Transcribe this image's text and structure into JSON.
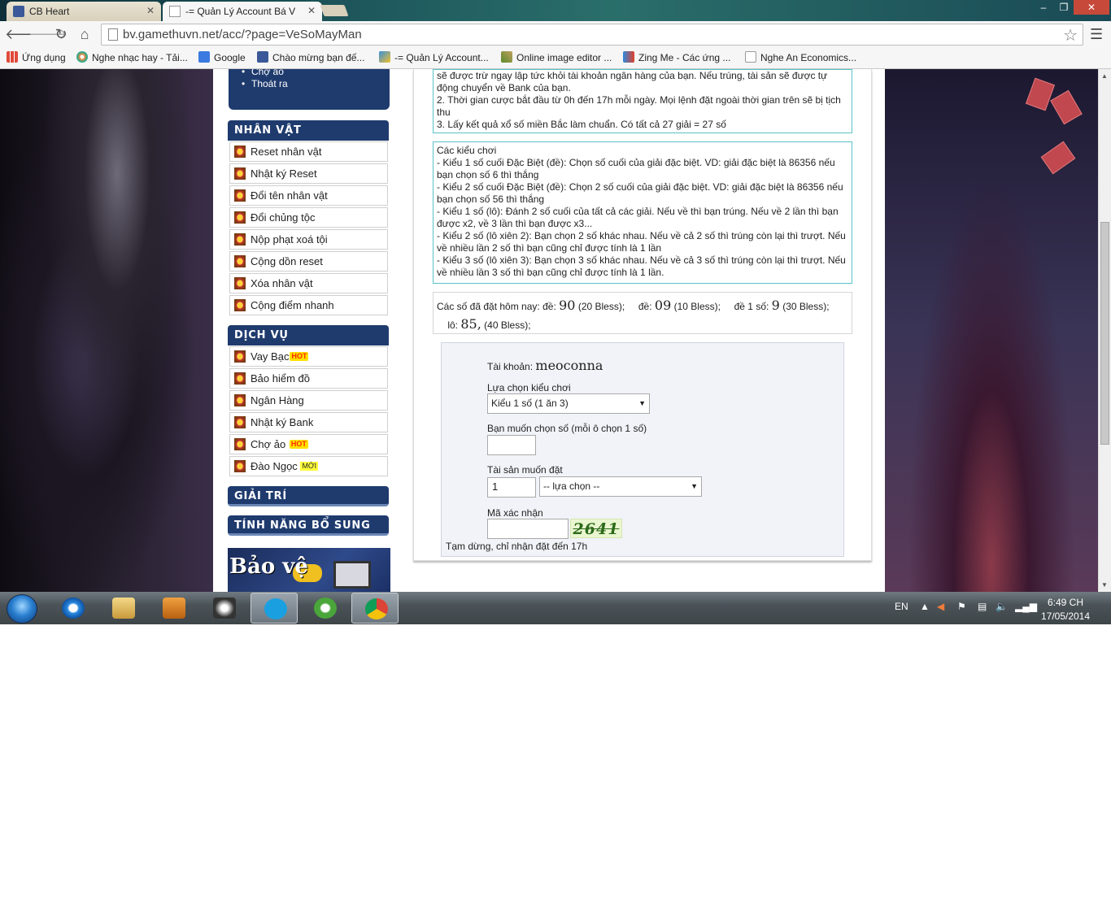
{
  "browser": {
    "tabs": [
      {
        "title": "CB Heart",
        "active": false
      },
      {
        "title": "-= Quản Lý Account Bá V",
        "active": true
      }
    ],
    "url": "bv.gamethuvn.net/acc/?page=VeSoMayMan",
    "window_controls": [
      "–",
      "❐",
      "✕"
    ]
  },
  "bookmarks": [
    {
      "label": "Ứng dụng",
      "icon": "apps-grid-icon"
    },
    {
      "label": "Nghe nhạc hay - Tải...",
      "icon": "music-icon"
    },
    {
      "label": "Google",
      "icon": "google-icon"
    },
    {
      "label": "Chào mừng bạn đế...",
      "icon": "facebook-icon"
    },
    {
      "label": "-= Quản Lý Account...",
      "icon": "feather-icon"
    },
    {
      "label": "Online image editor ...",
      "icon": "pencil-icon"
    },
    {
      "label": "Zing Me - Các ứng ...",
      "icon": "play-icon"
    },
    {
      "label": "Nghe An Economics...",
      "icon": "page-icon"
    }
  ],
  "sidebar": {
    "top_links": [
      "Chợ ảo",
      "Thoát ra"
    ],
    "nhan_vat": {
      "header": "NHÂN VẬT",
      "items": [
        "Reset nhân vật",
        "Nhật ký Reset",
        "Đổi tên nhân vật",
        "Đổi chủng tộc",
        "Nộp phạt xoá tội",
        "Cộng dồn reset",
        "Xóa nhân vật",
        "Cộng điểm nhanh"
      ]
    },
    "dich_vu": {
      "header": "DỊCH VỤ",
      "items": [
        {
          "label": "Vay Bạc",
          "badge": "HOT"
        },
        {
          "label": "Bảo hiểm đồ",
          "badge": ""
        },
        {
          "label": "Ngân Hàng",
          "badge": ""
        },
        {
          "label": "Nhật ký Bank",
          "badge": ""
        },
        {
          "label": "Chợ ảo",
          "badge": "HOT"
        },
        {
          "label": "Đào Ngọc",
          "badge": "MỚI"
        }
      ]
    },
    "giai_tri": {
      "header": "GIẢI TRÍ"
    },
    "tinh_nang": {
      "header": "TÍNH NĂNG BỔ SUNG"
    },
    "promo_text": "Bảo vệ"
  },
  "rules": {
    "line1": "sẽ được trừ ngay lập tức khỏi tài khoản ngân hàng của bạn. Nếu trúng, tài sản sẽ được tự động chuyển về Bank của bạn.",
    "line2": "2. Thời gian cược bắt đầu từ 0h đến 17h mỗi ngày. Mọi lệnh đặt ngoài thời gian trên sẽ bị tịch thu",
    "line3": "3. Lấy kết quả xổ số miền Bắc làm chuẩn. Có tất cả 27 giải = 27 số"
  },
  "play_types": {
    "title": "Các kiểu chơi",
    "lines": [
      "- Kiểu 1 số cuối Đặc Biệt (đề): Chọn số cuối của giải đặc biệt. VD: giải đặc biệt là 86356 nếu bạn chọn số 6 thì thắng",
      "- Kiểu 2 số cuối Đặc Biệt (đề): Chọn 2 số cuối của giải đặc biệt. VD: giải đặc biệt là 86356 nếu bạn chọn số 56 thì thắng",
      "- Kiểu 1 số (lô): Đánh 2 số cuối của tất cả các giải. Nếu về thì bạn trúng. Nếu về 2 lần thì bạn được x2, về 3 lần thì bạn được x3...",
      "- Kiểu 2 số (lô xiên 2): Bạn chọn 2 số khác nhau. Nếu về cả 2 số thì trúng còn lại thì trượt. Nếu về nhiều lần 2 số thì bạn cũng chỉ được tính là 1 lần",
      "- Kiểu 3 số (lô xiên 3): Bạn chọn 3 số khác nhau. Nếu về cả 3 số thì trúng còn lại thì trượt. Nếu về nhiều lần 3 số thì bạn cũng chỉ được tính là 1 lần."
    ]
  },
  "placed_today": {
    "prefix": "Các số đã đặt hôm nay:",
    "bets": [
      {
        "label": "đề:",
        "number": "90",
        "stake": "(20 Bless);"
      },
      {
        "label": "đề:",
        "number": "09",
        "stake": "(10 Bless);"
      },
      {
        "label": "đề 1 số:",
        "number": "9",
        "stake": "(30 Bless);"
      },
      {
        "label": "lô:",
        "number": "85,",
        "stake": "(40 Bless);"
      }
    ]
  },
  "form": {
    "account_label": "Tài khoản:",
    "account_value": "meoconna",
    "type_label": "Lựa chọn kiểu chơi",
    "type_value": "Kiểu 1 số (1 ăn 3)",
    "number_label": "Bạn muốn chọn số (mỗi ô chọn 1 số)",
    "number_value": "",
    "asset_label": "Tài sản muốn đặt",
    "asset_amount": "1",
    "asset_select": "-- lựa chọn --",
    "captcha_label": "Mã xác nhận",
    "captcha_value": "",
    "captcha_image_text": "2641",
    "notice": "Tạm dừng, chỉ nhận đặt đến 17h"
  },
  "taskbar": {
    "language": "EN",
    "time": "6:49 CH",
    "date": "17/05/2014"
  },
  "colors": {
    "sidebar_header": "#1f3b6e",
    "info_border": "#59c1c8",
    "form_bg": "#f1f3f8"
  }
}
